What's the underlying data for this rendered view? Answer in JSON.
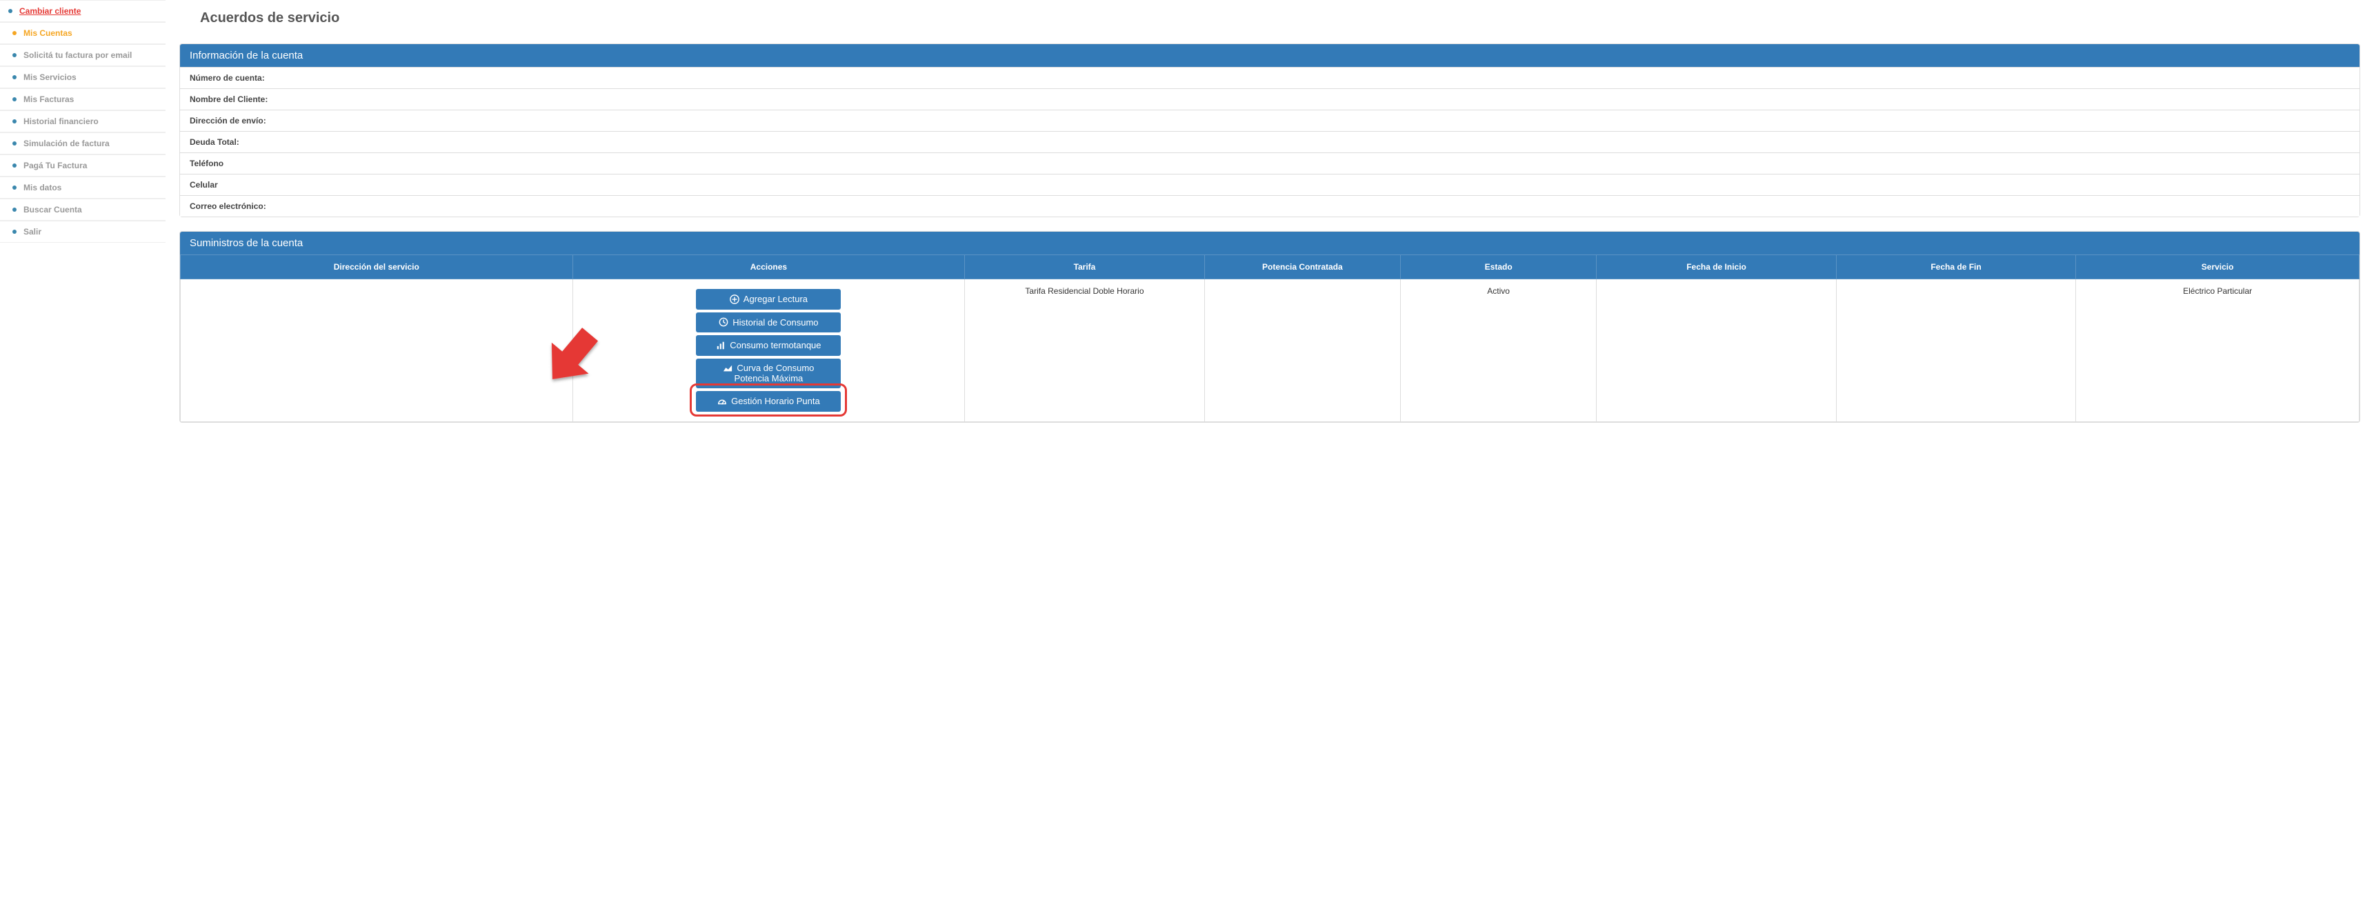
{
  "sidebar": {
    "change_client": "Cambiar cliente",
    "items": [
      {
        "label": "Mis Cuentas",
        "active": true
      },
      {
        "label": "Solicitá tu factura por email"
      },
      {
        "label": "Mis Servicios"
      },
      {
        "label": "Mis Facturas"
      },
      {
        "label": "Historial financiero"
      },
      {
        "label": "Simulación de factura"
      },
      {
        "label": "Pagá Tu Factura"
      },
      {
        "label": "Mis datos"
      },
      {
        "label": "Buscar Cuenta"
      },
      {
        "label": "Salir"
      }
    ]
  },
  "page": {
    "title": "Acuerdos de servicio"
  },
  "account_info": {
    "heading": "Información de la cuenta",
    "fields": {
      "numero": "Número de cuenta:",
      "nombre": "Nombre del Cliente:",
      "direccion": "Dirección de envío:",
      "deuda": "Deuda Total:",
      "telefono": "Teléfono",
      "celular": "Celular",
      "correo": "Correo electrónico:"
    }
  },
  "supplies": {
    "heading": "Suministros de la cuenta",
    "columns": {
      "direccion": "Dirección del servicio",
      "acciones": "Acciones",
      "tarifa": "Tarifa",
      "potencia": "Potencia Contratada",
      "estado": "Estado",
      "fecha_inicio": "Fecha de Inicio",
      "fecha_fin": "Fecha de Fin",
      "servicio": "Servicio"
    },
    "row": {
      "direccion": "",
      "tarifa": "Tarifa Residencial Doble Horario",
      "potencia": "",
      "estado": "Activo",
      "fecha_inicio": "",
      "fecha_fin": "",
      "servicio": "Eléctrico Particular"
    },
    "actions": {
      "agregar": "Agregar Lectura",
      "historial": "Historial de Consumo",
      "termotanque": "Consumo termotanque",
      "curva_l1": "Curva de Consumo",
      "curva_l2": "Potencia Máxima",
      "gestion": "Gestión Horario Punta"
    }
  }
}
